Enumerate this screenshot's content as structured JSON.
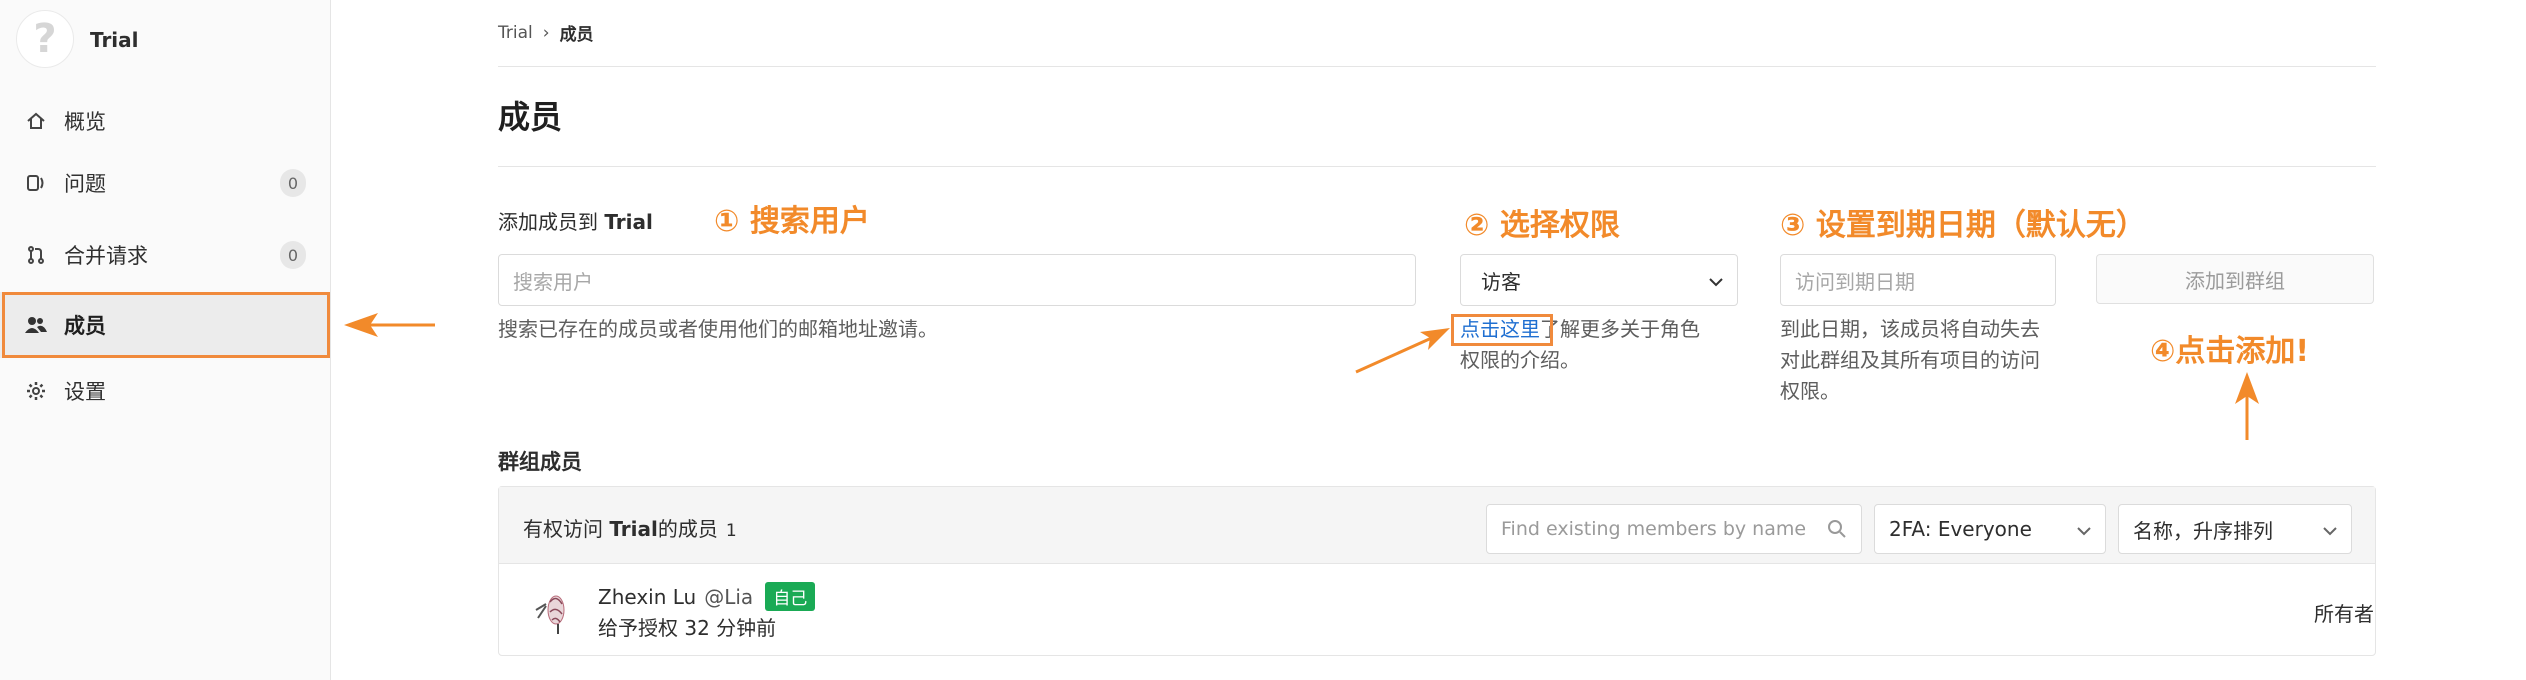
{
  "sidebar": {
    "group_name": "Trial",
    "items": [
      {
        "label": "概览",
        "icon": "home-icon"
      },
      {
        "label": "问题",
        "icon": "issues-icon",
        "count": "0"
      },
      {
        "label": "合并请求",
        "icon": "merge-request-icon",
        "count": "0"
      },
      {
        "label": "成员",
        "icon": "users-icon",
        "active": true
      },
      {
        "label": "设置",
        "icon": "gear-icon"
      }
    ]
  },
  "breadcrumb": {
    "root": "Trial",
    "current": "成员"
  },
  "page": {
    "title": "成员"
  },
  "invite": {
    "label_prefix": "添加成员到 ",
    "label_group": "Trial",
    "search_placeholder": "搜索用户",
    "search_help": "搜索已存在的成员或者使用他们的邮箱地址邀请。",
    "role_value": "访客",
    "role_link": "点击这里",
    "role_help_line1": "了解更多关于角色",
    "role_help_line2": "权限的介绍。",
    "expiry_placeholder": "访问到期日期",
    "expiry_help_line1": "到此日期，该成员将自动失去",
    "expiry_help_line2": "对此群组及其所有项目的访问",
    "expiry_help_line3": "权限。",
    "add_button": "添加到群组"
  },
  "annotations": {
    "step1": "① 搜索用户",
    "step2": "② 选择权限",
    "step3": "③ 设置到期日期（默认无）",
    "step4": "④点击添加!"
  },
  "members": {
    "section_title": "群组成员",
    "head_prefix": "有权访问 ",
    "head_group": "Trial",
    "head_suffix": "的成员",
    "count": "1",
    "filter_placeholder": "Find existing members by name",
    "twofa_value": "2FA: Everyone",
    "sort_value": "名称，升序排列",
    "list": [
      {
        "name": "Zhexin Lu",
        "username": "@Lia",
        "badge": "自己",
        "granted": "给予授权 32 分钟前",
        "role": "所有者"
      }
    ]
  },
  "colors": {
    "accent_orange": "#f28a2a",
    "link_blue": "#1f6fd1",
    "badge_green": "#1aaa55"
  }
}
